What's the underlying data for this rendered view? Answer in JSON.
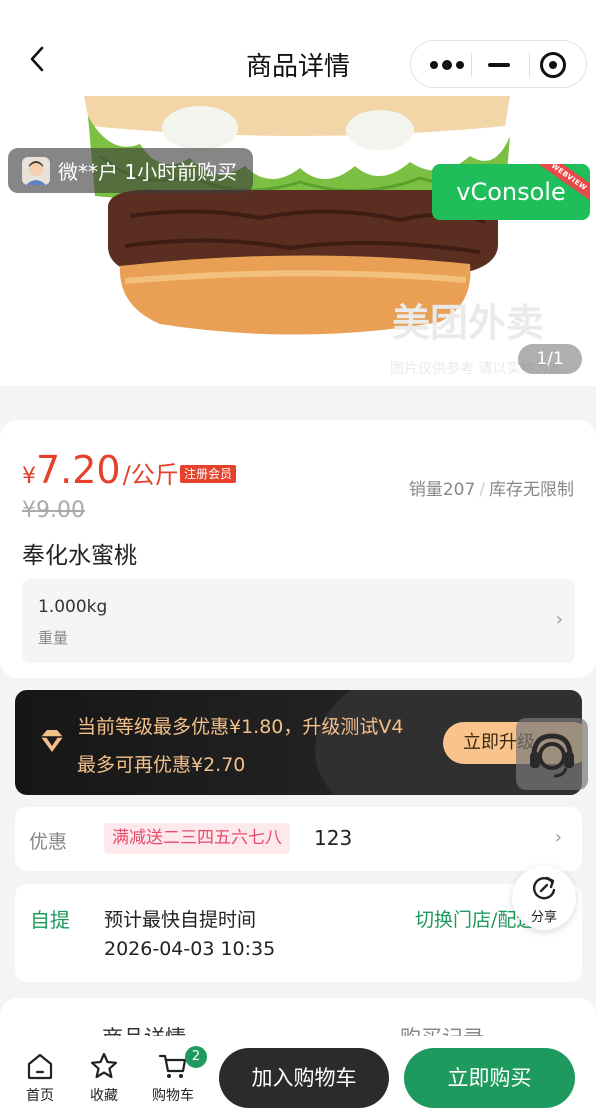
{
  "header": {
    "title": "商品详情"
  },
  "gallery": {
    "buyer_notice": "微**户 1小时前购买",
    "vconsole_label": "vConsole",
    "vconsole_ribbon": "WEBVIEW",
    "watermark": "美团外卖",
    "watermark_sub": "图片仅供参考 请以实物为准",
    "counter": "1/1"
  },
  "product": {
    "price_symbol": "¥",
    "price": "7.20",
    "unit": "/公斤",
    "member_tag": "注册会员",
    "sales": "销量207",
    "stock": "库存无限制",
    "original_price": "¥9.00",
    "name": "奉化水蜜桃",
    "spec_value": "1.000kg",
    "spec_label": "重量"
  },
  "member": {
    "line1": "当前等级最多优惠¥1.80，升级测试V4",
    "line2": "最多可再优惠¥2.70",
    "button": "立即升级"
  },
  "promo": {
    "label": "优惠",
    "tag": "满减送二三四五六七八",
    "value": "123"
  },
  "pickup": {
    "label": "自提",
    "title": "预计最快自提时间",
    "time": "2026-04-03 10:35",
    "switch": "切换门店/配送"
  },
  "share": {
    "label": "分享"
  },
  "tabs": {
    "detail": "商品详情",
    "record": "购买记录"
  },
  "bottom": {
    "home": "首页",
    "favorite": "收藏",
    "cart": "购物车",
    "cart_count": "2",
    "add_to_cart": "加入购物车",
    "buy_now": "立即购买"
  },
  "colors": {
    "accent_green": "#1f9a5e",
    "price_red": "#e5412b",
    "gold": "#f3c08a"
  }
}
